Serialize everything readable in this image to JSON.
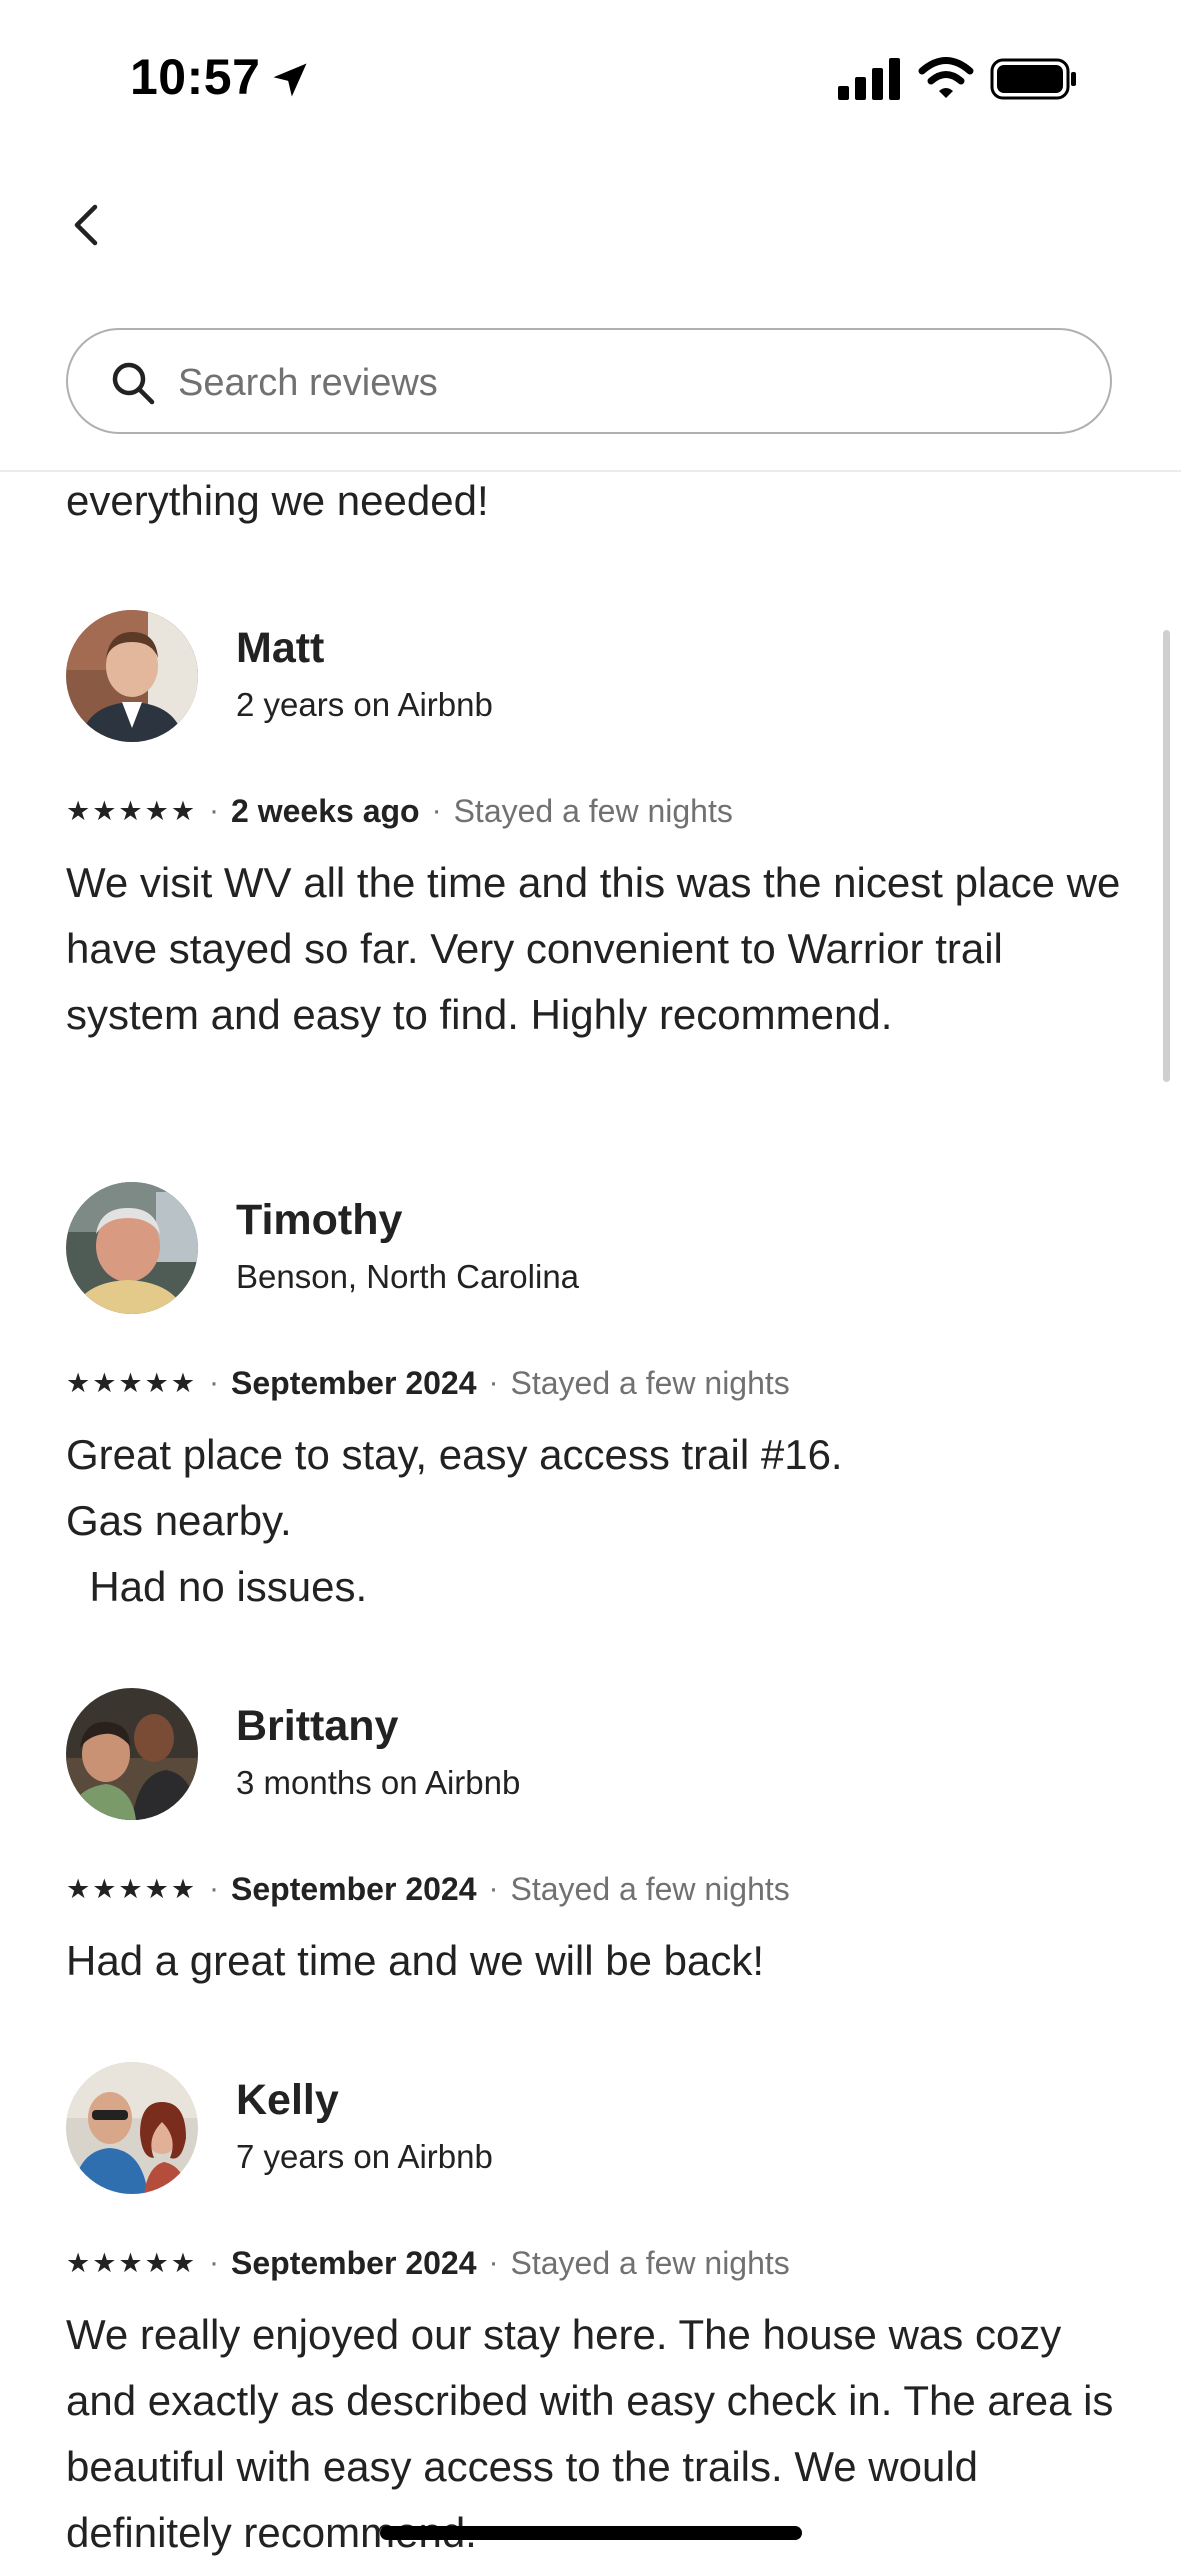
{
  "status_bar": {
    "time": "10:57"
  },
  "search": {
    "placeholder": "Search reviews",
    "value": ""
  },
  "partial_review_text": "everything we needed!",
  "reviews": [
    {
      "name": "Matt",
      "subtitle": "2 years on Airbnb",
      "rating": "★★★★★",
      "date": "2 weeks ago",
      "stay": "Stayed a few nights",
      "text": "We visit WV all the time and this was the nicest place we have stayed so far. Very convenient to Warrior trail system and easy to find. Highly recommend."
    },
    {
      "name": "Timothy",
      "subtitle": "Benson, North Carolina",
      "rating": "★★★★★",
      "date": "September 2024",
      "stay": "Stayed a few nights",
      "text": "Great place to stay, easy access trail #16.\nGas nearby.\n  Had no issues."
    },
    {
      "name": "Brittany",
      "subtitle": "3 months on Airbnb",
      "rating": "★★★★★",
      "date": "September 2024",
      "stay": "Stayed a few nights",
      "text": "Had a great time and we will be back!"
    },
    {
      "name": "Kelly",
      "subtitle": "7 years on Airbnb",
      "rating": "★★★★★",
      "date": "September 2024",
      "stay": "Stayed a few nights",
      "text": "We really enjoyed our stay here. The house was cozy and exactly as described with easy check in. The area is beautiful with easy access to the trails. We would definitely recommend."
    }
  ],
  "icons": {
    "back": "chevron-left-icon",
    "search": "search-icon",
    "location": "location-arrow-icon",
    "signal": "cellular-signal-icon",
    "wifi": "wifi-icon",
    "battery": "battery-icon"
  }
}
